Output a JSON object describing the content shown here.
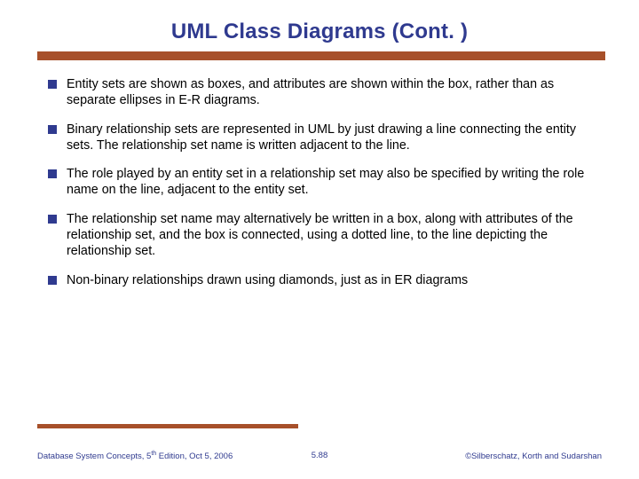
{
  "title": "UML Class Diagrams (Cont. )",
  "bullets": [
    "Entity sets are shown as boxes, and attributes are shown within  the box, rather than as separate ellipses in E-R diagrams.",
    "Binary relationship sets are represented in UML by just drawing a line connecting the entity sets. The relationship set name is written adjacent to the line.",
    " The role played by an entity set in a relationship set may also be specified by writing the role name on the line, adjacent to the entity set.",
    " The relationship set name may alternatively be written in a box, along with attributes of the relationship set, and the box is connected, using a dotted line, to the line depicting the  relationship set.",
    "  Non-binary relationships drawn using diamonds, just as in ER diagrams"
  ],
  "footer": {
    "left_prefix": "Database System Concepts, 5",
    "left_sup": "th",
    "left_suffix": " Edition, Oct 5, 2006",
    "center": "5.88",
    "right": "©Silberschatz, Korth and Sudarshan"
  }
}
